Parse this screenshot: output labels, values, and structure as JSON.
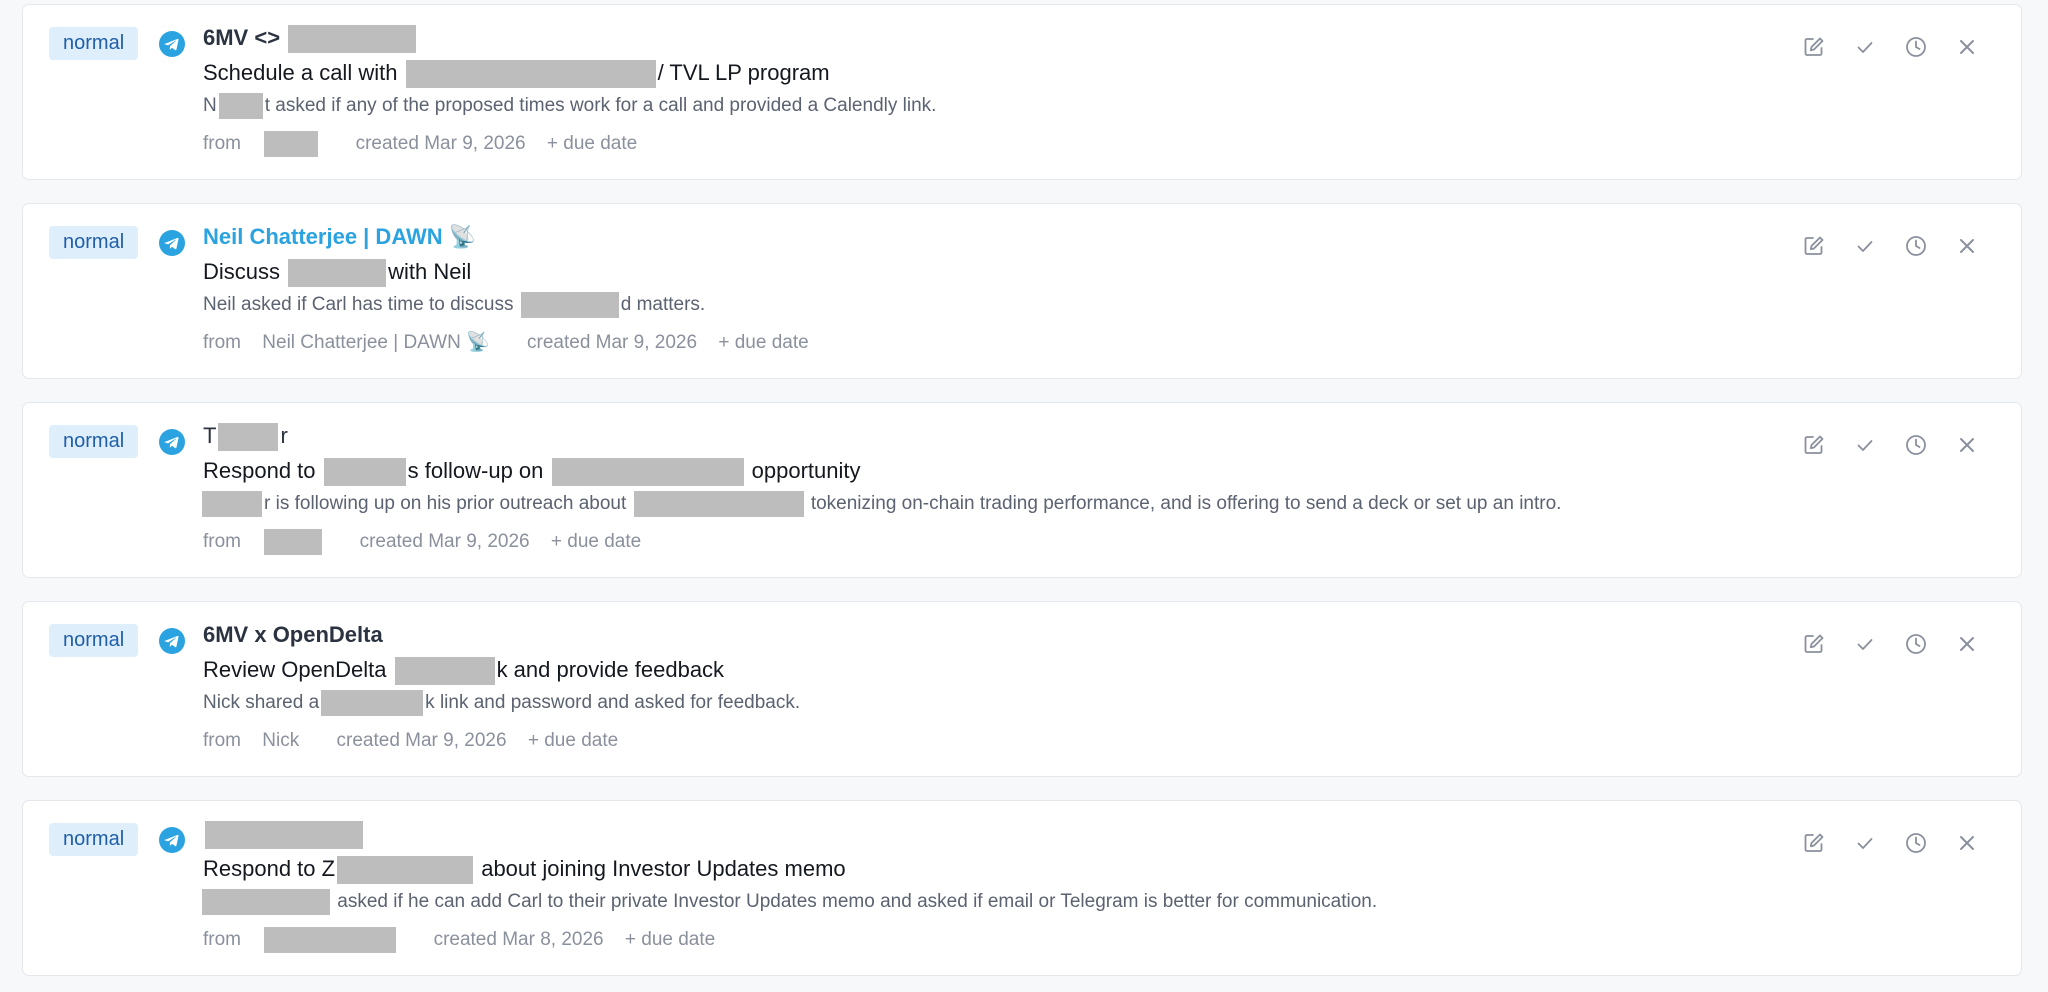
{
  "tasks": [
    {
      "priority": "normal",
      "sender": "6MV <>",
      "title_pre": "Schedule a call with",
      "title_post": "/ TVL LP program",
      "summary_pre": "N",
      "summary_post": "t asked if any of the proposed times work for a call and provided a Calendly link.",
      "from_label": "from",
      "from_name": "",
      "created": "created Mar 9, 2026",
      "due_label": "+ due date"
    },
    {
      "priority": "normal",
      "sender": "Neil Chatterjee | DAWN 📡",
      "title_pre": "Discuss",
      "title_post": "with Neil",
      "summary_pre": "Neil asked if Carl has time to discuss",
      "summary_post": "d matters.",
      "from_label": "from",
      "from_name": "Neil Chatterjee | DAWN 📡",
      "created": "created Mar 9, 2026",
      "due_label": "+ due date"
    },
    {
      "priority": "normal",
      "sender_pre": "T",
      "sender_post": "r",
      "title_pre": "Respond to",
      "title_mid": "s follow-up on",
      "title_post": "opportunity",
      "summary_pre": "",
      "summary_mid": "r is following up on his prior outreach about",
      "summary_post": "tokenizing on-chain trading performance, and is offering to send a deck or set up an intro.",
      "from_label": "from",
      "from_name": "",
      "created": "created Mar 9, 2026",
      "due_label": "+ due date"
    },
    {
      "priority": "normal",
      "sender": "6MV x OpenDelta",
      "title_pre": "Review OpenDelta",
      "title_post": "k and provide feedback",
      "summary_pre": "Nick shared a",
      "summary_post": "k link and password and asked for feedback.",
      "from_label": "from",
      "from_name": "Nick",
      "created": "created Mar 9, 2026",
      "due_label": "+ due date"
    },
    {
      "priority": "normal",
      "sender": "",
      "title_pre": "Respond to Z",
      "title_post": "about joining Investor Updates memo",
      "summary_pre": "",
      "summary_post": "asked if he can add Carl to their private Investor Updates memo and asked if email or Telegram is better for communication.",
      "from_label": "from",
      "from_name": "",
      "created": "created Mar 8, 2026",
      "due_label": "+ due date"
    }
  ],
  "icons": {
    "source": "telegram-icon",
    "edit": "edit-icon",
    "done": "check-icon",
    "snooze": "clock-icon",
    "dismiss": "close-icon"
  },
  "colors": {
    "badge_bg": "#dfeefb",
    "badge_text": "#1f5fa8",
    "telegram": "#2aa3e0",
    "link_sender": "#2aa3e0",
    "redaction": "#bdbdbd"
  }
}
